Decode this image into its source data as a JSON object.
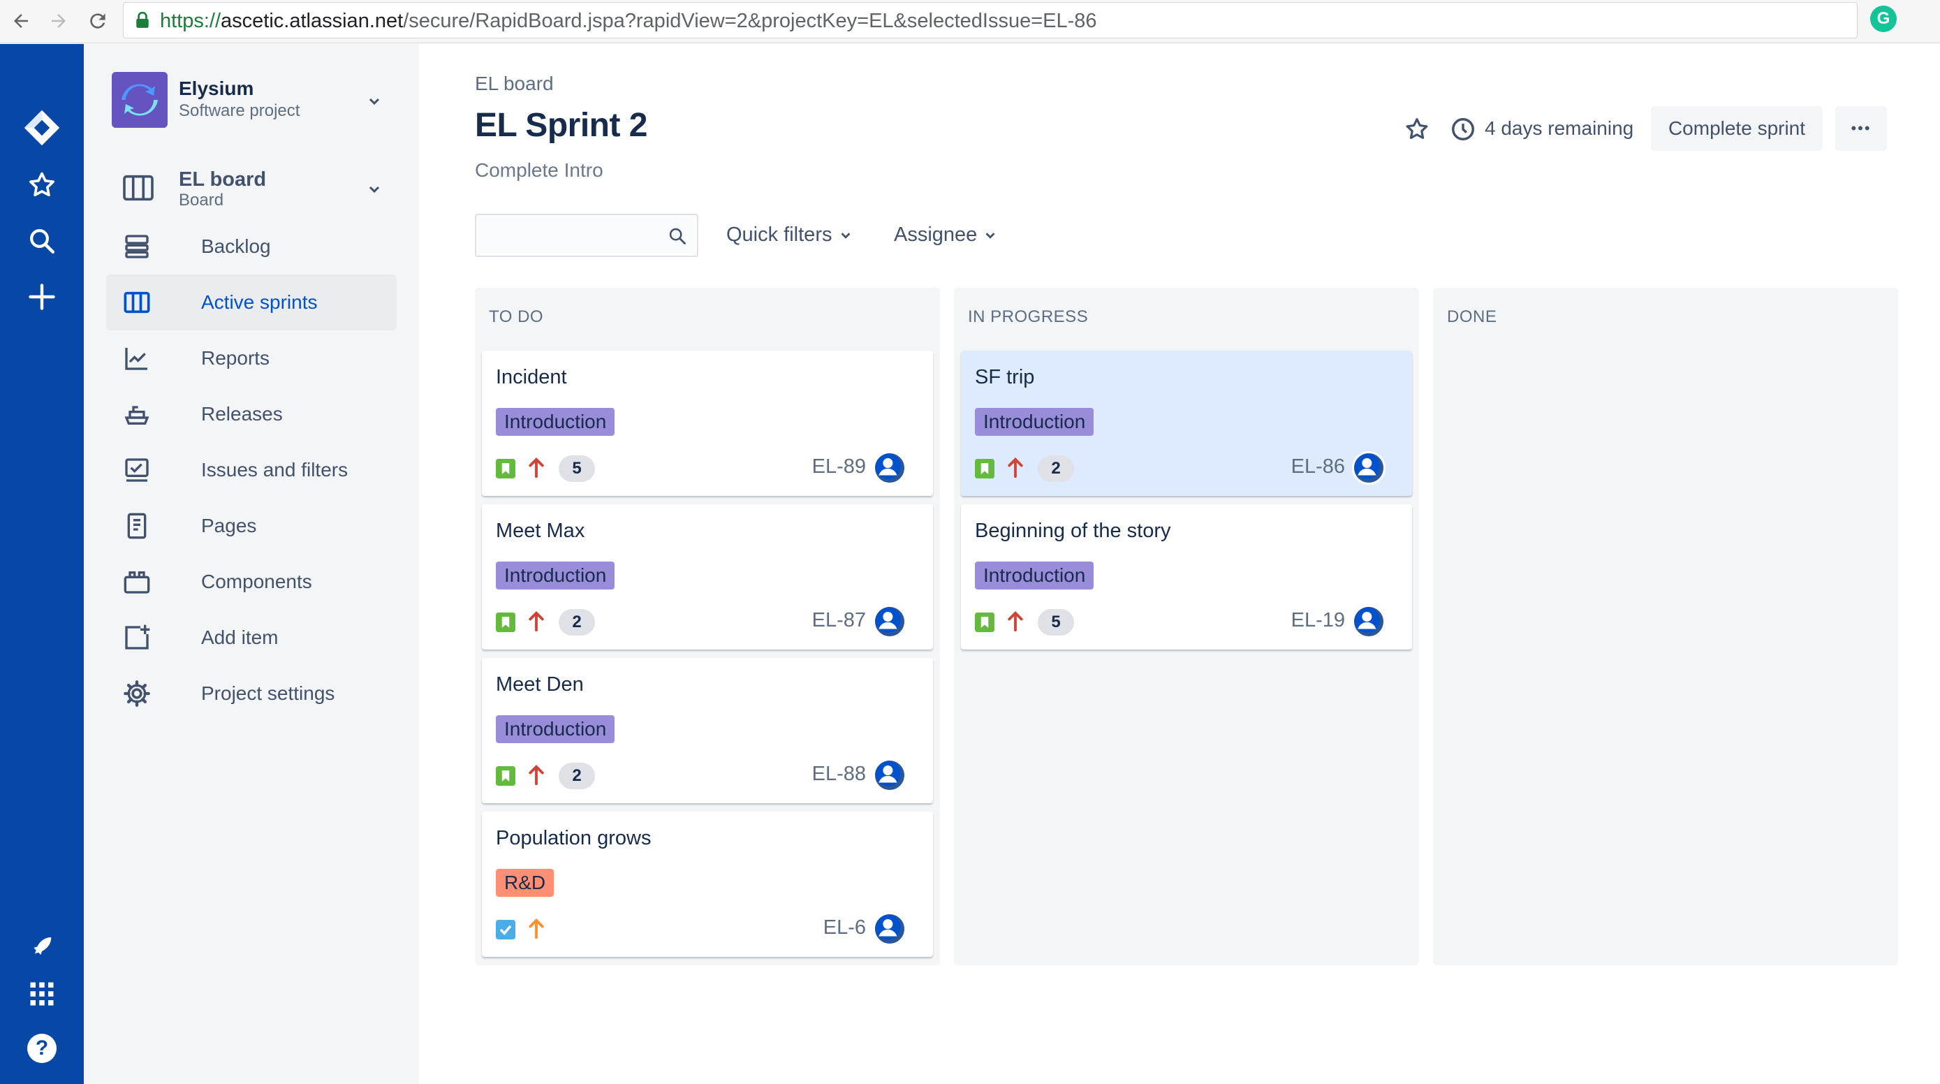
{
  "browser": {
    "url_scheme": "https://",
    "url_host": "ascetic.atlassian.net",
    "url_path": "/secure/RapidBoard.jspa?rapidView=2&projectKey=EL&selectedIssue=EL-86",
    "extension_letter": "G"
  },
  "global_nav": {
    "icons": [
      "jira-logo-icon",
      "star-icon",
      "search-icon",
      "plus-icon",
      "rocket-icon",
      "app-switcher-icon",
      "help-icon"
    ],
    "help_label": "?"
  },
  "sidebar": {
    "project_name": "Elysium",
    "project_type": "Software project",
    "board_name": "EL board",
    "board_type": "Board",
    "items": [
      {
        "label": "Backlog",
        "icon": "backlog-icon"
      },
      {
        "label": "Active sprints",
        "icon": "board-icon",
        "active": true
      },
      {
        "label": "Reports",
        "icon": "reports-icon"
      },
      {
        "label": "Releases",
        "icon": "releases-icon"
      },
      {
        "label": "Issues and filters",
        "icon": "issues-icon"
      },
      {
        "label": "Pages",
        "icon": "pages-icon"
      },
      {
        "label": "Components",
        "icon": "components-icon"
      },
      {
        "label": "Add item",
        "icon": "add-item-icon"
      },
      {
        "label": "Project settings",
        "icon": "gear-icon"
      }
    ]
  },
  "header": {
    "breadcrumb": "EL board",
    "title": "EL Sprint 2",
    "sprint_goal": "Complete Intro",
    "days_remaining": "4 days remaining",
    "complete_label": "Complete sprint",
    "more_label": "•••"
  },
  "filters": {
    "search_placeholder": "",
    "quick_filters": "Quick filters",
    "assignee": "Assignee"
  },
  "colors": {
    "global_nav": "#0747a6",
    "epic_introduction": "#998dd9",
    "epic_rnd": "#ff8f73",
    "story": "#63ba3c",
    "task": "#4bade8",
    "priority_high": "#d04437",
    "priority_medium": "#f79232",
    "selected_card": "#deebff"
  },
  "columns": [
    {
      "title": "TO DO",
      "cards": [
        {
          "title": "Incident",
          "epic": "Introduction",
          "type": "story",
          "priority": "high",
          "estimate": "5",
          "key": "EL-89"
        },
        {
          "title": "Meet Max",
          "epic": "Introduction",
          "type": "story",
          "priority": "high",
          "estimate": "2",
          "key": "EL-87"
        },
        {
          "title": "Meet Den",
          "epic": "Introduction",
          "type": "story",
          "priority": "high",
          "estimate": "2",
          "key": "EL-88"
        },
        {
          "title": "Population grows",
          "epic": "R&D",
          "type": "task",
          "priority": "medium",
          "estimate": "",
          "key": "EL-6"
        }
      ]
    },
    {
      "title": "IN PROGRESS",
      "cards": [
        {
          "title": "SF trip",
          "epic": "Introduction",
          "type": "story",
          "priority": "high",
          "estimate": "2",
          "key": "EL-86",
          "selected": true
        },
        {
          "title": "Beginning of the story",
          "epic": "Introduction",
          "type": "story",
          "priority": "high",
          "estimate": "5",
          "key": "EL-19"
        }
      ]
    },
    {
      "title": "DONE",
      "cards": []
    }
  ]
}
